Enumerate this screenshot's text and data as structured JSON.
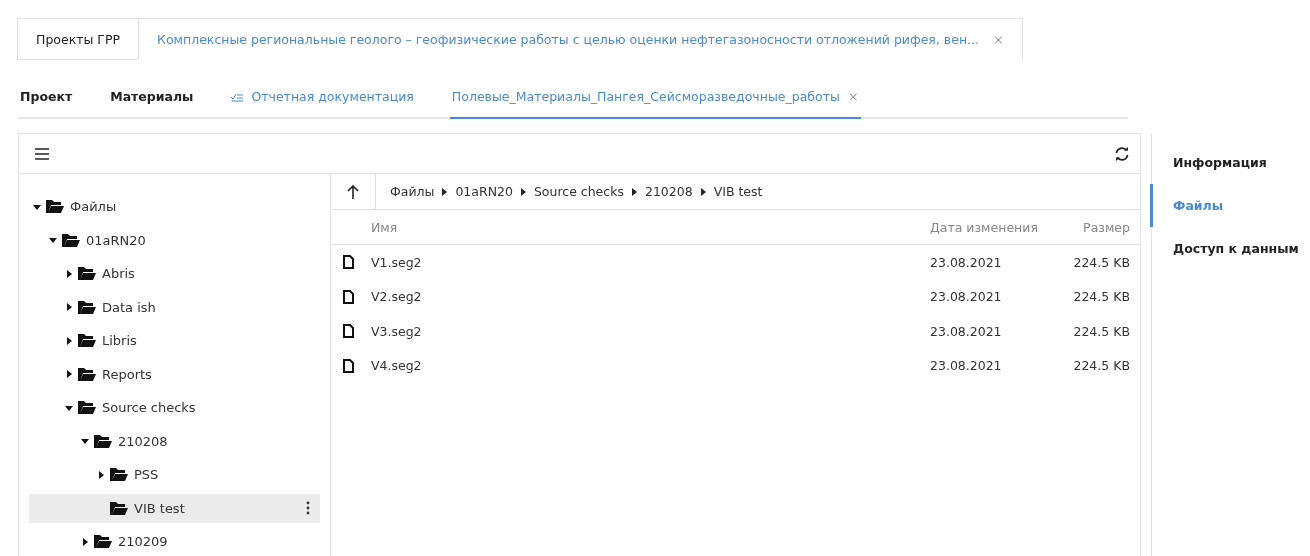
{
  "top_tabs": [
    {
      "label": "Проекты ГРР",
      "selected": false,
      "closable": false
    },
    {
      "label": "Комплексные региональные геолого – геофизические работы с целью оценки нефтегазоносности отложений рифея, вен...",
      "selected": true,
      "closable": true,
      "close": "×"
    }
  ],
  "sub_tabs": [
    {
      "label": "Проект",
      "selected": false,
      "kind": "plain"
    },
    {
      "label": "Материалы",
      "selected": false,
      "kind": "plain"
    },
    {
      "label": "Отчетная документация",
      "selected": false,
      "kind": "link"
    },
    {
      "label": "Полевые_Материалы_Пангея_Сейсморазведочные_работы",
      "selected": true,
      "kind": "closable",
      "close": "×"
    }
  ],
  "tree": [
    {
      "label": "Файлы",
      "expandable": true,
      "expanded": true,
      "selected": false,
      "children": [
        {
          "label": "01aRN20",
          "expandable": true,
          "expanded": true,
          "selected": false,
          "children": [
            {
              "label": "Abris",
              "expandable": true,
              "expanded": false,
              "selected": false
            },
            {
              "label": "Data ish",
              "expandable": true,
              "expanded": false,
              "selected": false
            },
            {
              "label": "Libris",
              "expandable": true,
              "expanded": false,
              "selected": false
            },
            {
              "label": "Reports",
              "expandable": true,
              "expanded": false,
              "selected": false
            },
            {
              "label": "Source checks",
              "expandable": true,
              "expanded": true,
              "selected": false,
              "children": [
                {
                  "label": "210208",
                  "expandable": true,
                  "expanded": true,
                  "selected": false,
                  "children": [
                    {
                      "label": "PSS",
                      "expandable": true,
                      "expanded": false,
                      "selected": false
                    },
                    {
                      "label": "VIB test",
                      "expandable": false,
                      "expanded": false,
                      "selected": true
                    }
                  ]
                },
                {
                  "label": "210209",
                  "expandable": true,
                  "expanded": false,
                  "selected": false
                }
              ]
            }
          ]
        }
      ]
    }
  ],
  "breadcrumb": [
    "Файлы",
    "01aRN20",
    "Source checks",
    "210208",
    "VIB test"
  ],
  "table": {
    "columns": [
      "Имя",
      "Дата изменения",
      "Размер"
    ],
    "rows": [
      {
        "name": "V1.seg2",
        "date": "23.08.2021",
        "size": "224.5 KB"
      },
      {
        "name": "V2.seg2",
        "date": "23.08.2021",
        "size": "224.5 KB"
      },
      {
        "name": "V3.seg2",
        "date": "23.08.2021",
        "size": "224.5 KB"
      },
      {
        "name": "V4.seg2",
        "date": "23.08.2021",
        "size": "224.5 KB"
      }
    ]
  },
  "side_nav": [
    {
      "label": "Информация",
      "selected": false
    },
    {
      "label": "Файлы",
      "selected": true
    },
    {
      "label": "Доступ к данным",
      "selected": false
    }
  ]
}
